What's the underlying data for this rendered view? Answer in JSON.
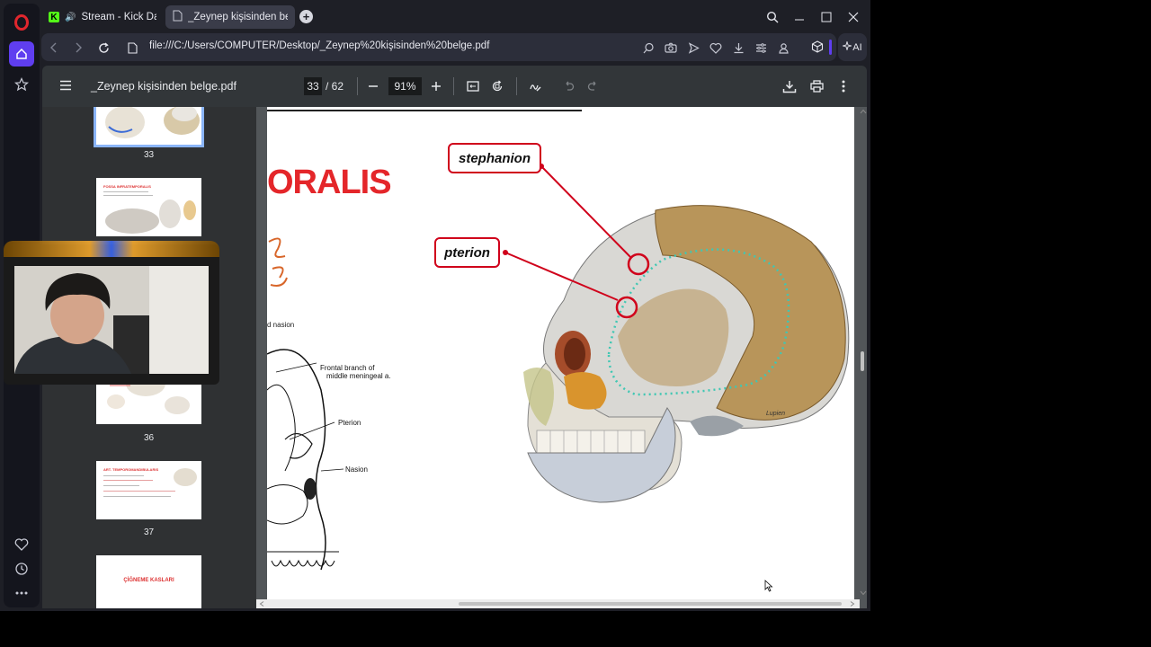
{
  "tabs": [
    {
      "title": "Stream - Kick Dashboa",
      "audio_icon": "speaker-icon"
    },
    {
      "title": "_Zeynep kişisinden belge.p",
      "active": true
    }
  ],
  "address_bar": {
    "url": "file:///C:/Users/COMPUTER/Desktop/_Zeynep%20kişisinden%20belge.pdf"
  },
  "ai_label": "AI",
  "pdf": {
    "title": "_Zeynep kişisinden belge.pdf",
    "page_current": "33",
    "page_total": "/ 62",
    "zoom": "91%"
  },
  "thumbnails": [
    {
      "num": "33",
      "selected": true
    },
    {
      "num": "",
      "heading": "FOSSA INFRATEMPORALIS"
    },
    {
      "num": "36"
    },
    {
      "num": "37",
      "heading": "ART. TEMPOROMANDIBULARIS"
    },
    {
      "num": "",
      "heading": "ÇİĞNEME KASLARI"
    }
  ],
  "page_content": {
    "heading_fragment": "ORALIS",
    "label_stephanion": "stephanion",
    "label_pterion": "pterion",
    "text_nasion_top": "d nasion",
    "text_frontal_branch": "Frontal branch of",
    "text_meningeal": "middle meningeal a.",
    "text_pterion_small": "Pterion",
    "text_nasion": "Nasion",
    "signature": "Lupien"
  },
  "colors": {
    "accent": "#5f3ef0",
    "opera_red": "#e0262d",
    "callout_red": "#d0021b",
    "bone_tan": "#b8955a",
    "suture_teal": "#3fc7b3"
  }
}
